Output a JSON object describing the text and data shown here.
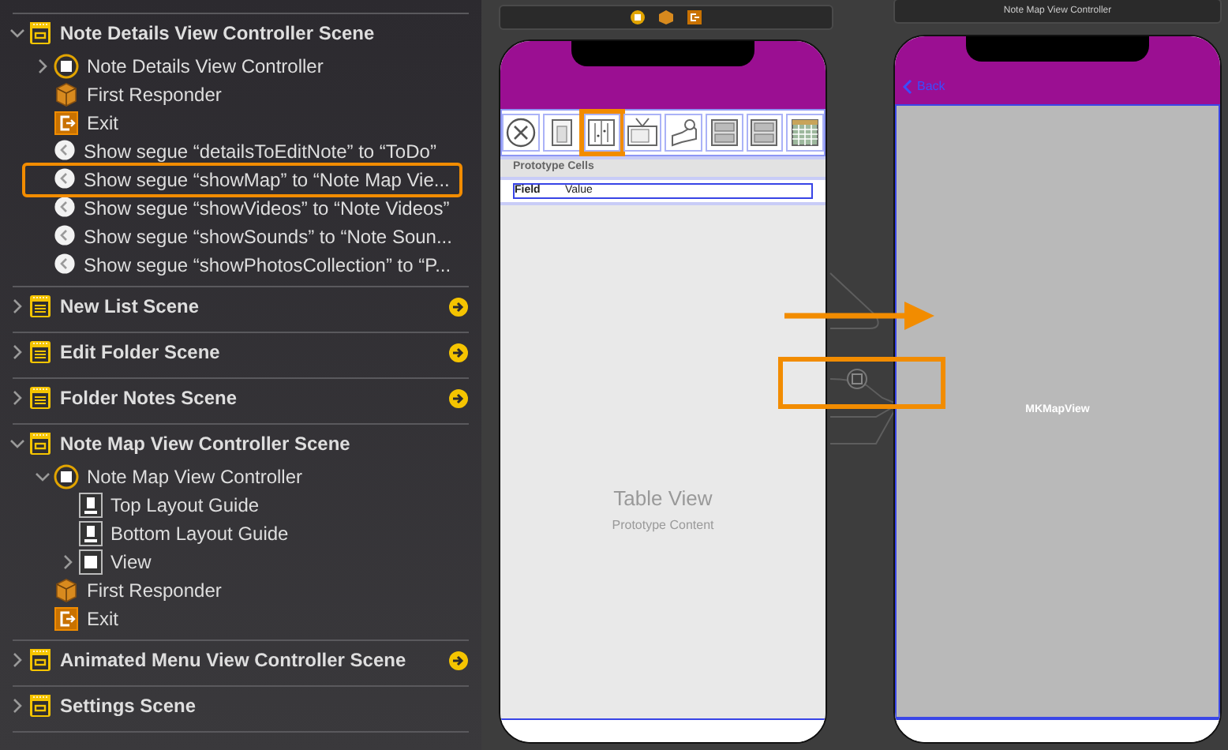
{
  "outline": {
    "scenes": [
      {
        "title": "Note Details View Controller Scene",
        "kind": "controller",
        "expanded": true,
        "jump": false,
        "children": [
          {
            "kind": "controller",
            "label": "Note Details View Controller",
            "expanded": false
          },
          {
            "kind": "responder",
            "label": "First Responder"
          },
          {
            "kind": "exit",
            "label": "Exit"
          },
          {
            "kind": "segue",
            "label": "Show segue “detailsToEditNote” to “ToDo”",
            "highlighted": false
          },
          {
            "kind": "segue",
            "label": "Show segue “showMap” to “Note Map Vie...",
            "highlighted": true
          },
          {
            "kind": "segue",
            "label": "Show segue “showVideos” to “Note Videos”",
            "highlighted": false
          },
          {
            "kind": "segue",
            "label": "Show segue “showSounds” to “Note Soun...",
            "highlighted": false
          },
          {
            "kind": "segue",
            "label": "Show segue “showPhotosCollection” to “P...",
            "highlighted": false
          }
        ]
      },
      {
        "title": "New List Scene",
        "kind": "table",
        "expanded": false,
        "jump": true
      },
      {
        "title": "Edit Folder Scene",
        "kind": "table",
        "expanded": false,
        "jump": true
      },
      {
        "title": "Folder Notes Scene",
        "kind": "table",
        "expanded": false,
        "jump": true
      },
      {
        "title": "Note Map View Controller Scene",
        "kind": "controller",
        "expanded": true,
        "jump": false,
        "children": [
          {
            "kind": "controller",
            "label": "Note Map View Controller",
            "expanded": true,
            "children": [
              {
                "kind": "guide",
                "label": "Top Layout Guide"
              },
              {
                "kind": "guide",
                "label": "Bottom Layout Guide"
              },
              {
                "kind": "view",
                "label": "View",
                "expanded": false
              }
            ]
          },
          {
            "kind": "responder",
            "label": "First Responder"
          },
          {
            "kind": "exit",
            "label": "Exit"
          }
        ]
      },
      {
        "title": "Animated Menu View Controller Scene",
        "kind": "controller",
        "expanded": false,
        "jump": true
      },
      {
        "title": "Settings Scene",
        "kind": "controller",
        "expanded": false,
        "jump": false
      }
    ]
  },
  "canvas": {
    "table_scene": {
      "toolbar_items": [
        {
          "kind": "close",
          "highlighted": false
        },
        {
          "kind": "page",
          "highlighted": false
        },
        {
          "kind": "doors",
          "highlighted": true
        },
        {
          "kind": "tv",
          "highlighted": false
        },
        {
          "kind": "projector",
          "highlighted": false
        },
        {
          "kind": "photos",
          "highlighted": false
        },
        {
          "kind": "photos",
          "highlighted": false
        },
        {
          "kind": "calendar",
          "highlighted": false
        }
      ],
      "section_header": "Prototype Cells",
      "cell": {
        "field": "Field",
        "value": "Value"
      },
      "placeholder_title": "Table View",
      "placeholder_subtitle": "Prototype Content"
    },
    "map_scene": {
      "title": "Note Map View Controller",
      "back": "Back",
      "map_label": "MKMapView"
    }
  }
}
